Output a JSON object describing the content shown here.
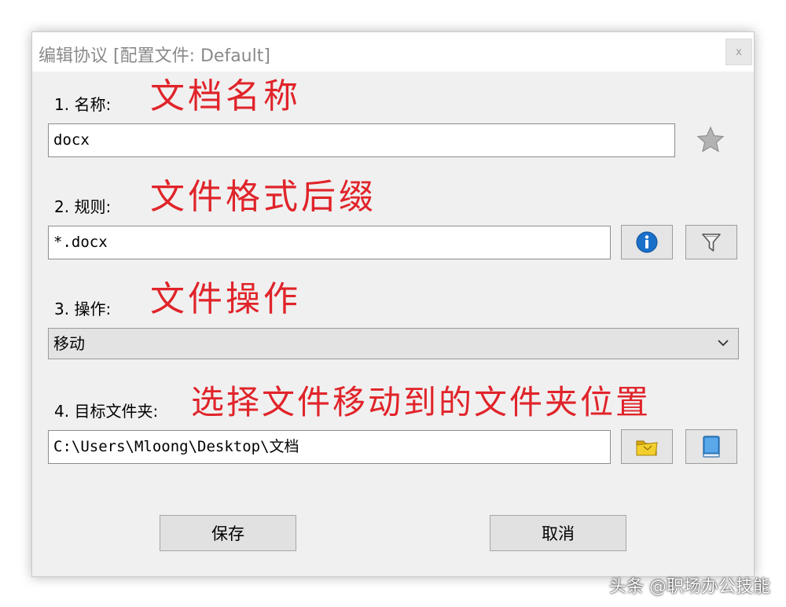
{
  "window": {
    "title": "编辑协议 [配置文件: Default]",
    "close_label": "x"
  },
  "fields": {
    "name": {
      "label": "1. 名称:",
      "value": "docx",
      "annotation": "文档名称"
    },
    "rule": {
      "label": "2. 规则:",
      "value": "*.docx",
      "annotation": "文件格式后缀"
    },
    "action": {
      "label": "3. 操作:",
      "selected": "移动",
      "annotation": "文件操作"
    },
    "target": {
      "label": "4. 目标文件夹:",
      "value": "C:\\Users\\Mloong\\Desktop\\文档",
      "annotation": "选择文件移动到的文件夹位置"
    }
  },
  "buttons": {
    "save": "保存",
    "cancel": "取消"
  },
  "watermark": "头条 @职场办公技能",
  "colors": {
    "annotation": "#e0242a",
    "dialog_bg": "#f0f0f0",
    "info_blue": "#1a6fc9",
    "folder_yellow": "#e8c01c",
    "book_blue": "#3a8fd8"
  },
  "icons": [
    "star-icon",
    "info-icon",
    "filter-icon",
    "folder-icon",
    "book-icon",
    "chevron-down-icon"
  ]
}
